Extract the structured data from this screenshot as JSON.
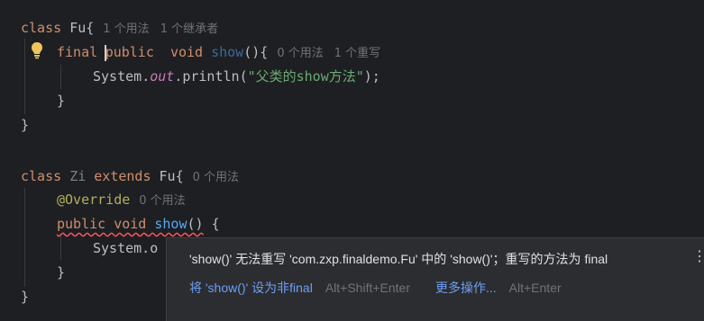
{
  "editor": {
    "hints": {
      "fu_usage": "1 个用法",
      "fu_inheritors": "1 个继承者",
      "show_usage": "0 个用法",
      "show_overrides": "1 个重写",
      "zi_usage": "0 个用法",
      "override_usage": "0 个用法"
    },
    "string_literal": "\"父类的show方法\"",
    "keywords": {
      "class": "class",
      "final": "final",
      "public": "public",
      "void": "void",
      "extends": "extends",
      "override": "@Override"
    },
    "identifiers": {
      "fu": "Fu",
      "zi": "Zi",
      "show": "show",
      "system": "System",
      "out": "out",
      "println": "println",
      "system_partial": "System.o"
    }
  },
  "popup": {
    "message": "'show()' 无法重写 'com.zxp.finaldemo.Fu' 中的 'show()'；重写的方法为 final",
    "action_primary": "将 'show()' 设为非final",
    "action_primary_shortcut": "Alt+Shift+Enter",
    "action_more": "更多操作...",
    "action_more_shortcut": "Alt+Enter",
    "more_icon": "⋮"
  },
  "colors": {
    "background": "#1e1f22",
    "keyword": "#cf8e6d",
    "method": "#56a8f5",
    "string": "#6aab73",
    "annotation": "#b3ae60",
    "error_underline": "#f75464",
    "bulb": "#f2c55c"
  }
}
